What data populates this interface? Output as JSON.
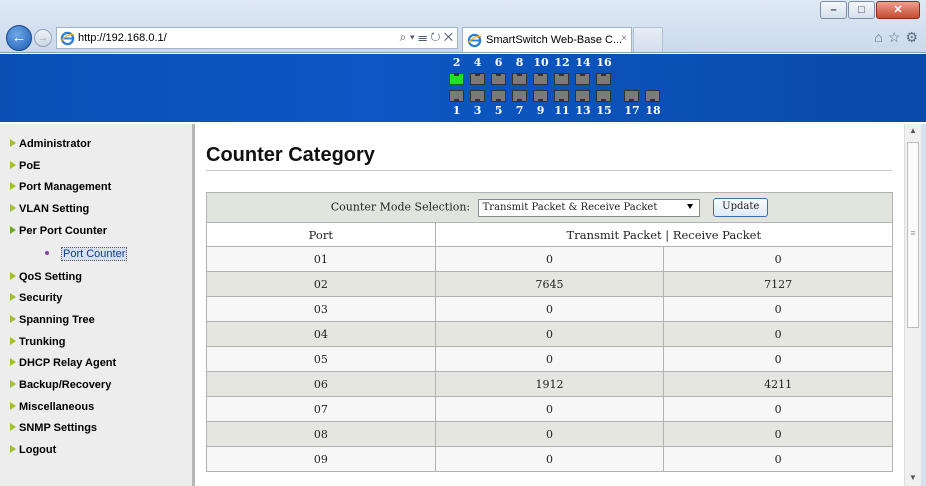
{
  "browser": {
    "url": "http://192.168.0.1/",
    "address_tools": "⌕ ▾ ☰ ↻ ✕",
    "tab_title": "SmartSwitch Web-Base C...",
    "tab_close": "×",
    "window_buttons": {
      "minimize": "–",
      "maximize": "□",
      "close": "✕"
    },
    "back_glyph": "←",
    "forward_glyph": "→",
    "right_tools": {
      "home": "⌂",
      "favorites": "☆",
      "settings": "⚙"
    }
  },
  "ports": {
    "top_labels": [
      "2",
      "4",
      "6",
      "8",
      "10",
      "12",
      "14",
      "16"
    ],
    "bottom_labels": [
      "1",
      "3",
      "5",
      "7",
      "9",
      "11",
      "13",
      "15",
      "17",
      "18"
    ],
    "link_up": [
      "2"
    ],
    "up_color": "#22e02a"
  },
  "sidebar": {
    "items": [
      {
        "label": "Administrator"
      },
      {
        "label": "PoE"
      },
      {
        "label": "Port Management"
      },
      {
        "label": "VLAN Setting"
      },
      {
        "label": "Per Port Counter",
        "expanded": true
      },
      {
        "label": "QoS Setting"
      },
      {
        "label": "Security"
      },
      {
        "label": "Spanning Tree"
      },
      {
        "label": "Trunking"
      },
      {
        "label": "DHCP Relay Agent"
      },
      {
        "label": "Backup/Recovery"
      },
      {
        "label": "Miscellaneous"
      },
      {
        "label": "SNMP Settings"
      },
      {
        "label": "Logout"
      }
    ],
    "sub_item": "Port Counter"
  },
  "main": {
    "title": "Counter Category",
    "mode_label": "Counter Mode Selection:",
    "mode_value": "Transmit Packet & Receive Packet",
    "update_button": "Update",
    "col_port": "Port",
    "col_counters": "Transmit Packet | Receive Packet",
    "rows": [
      {
        "port": "01",
        "tx": "0",
        "rx": "0"
      },
      {
        "port": "02",
        "tx": "7645",
        "rx": "7127"
      },
      {
        "port": "03",
        "tx": "0",
        "rx": "0"
      },
      {
        "port": "04",
        "tx": "0",
        "rx": "0"
      },
      {
        "port": "05",
        "tx": "0",
        "rx": "0"
      },
      {
        "port": "06",
        "tx": "1912",
        "rx": "4211"
      },
      {
        "port": "07",
        "tx": "0",
        "rx": "0"
      },
      {
        "port": "08",
        "tx": "0",
        "rx": "0"
      },
      {
        "port": "09",
        "tx": "0",
        "rx": "0"
      }
    ]
  },
  "colors": {
    "banner": "#0c57c4",
    "sidebar_bg": "#ededed",
    "row_alt": "#e4e6df"
  }
}
